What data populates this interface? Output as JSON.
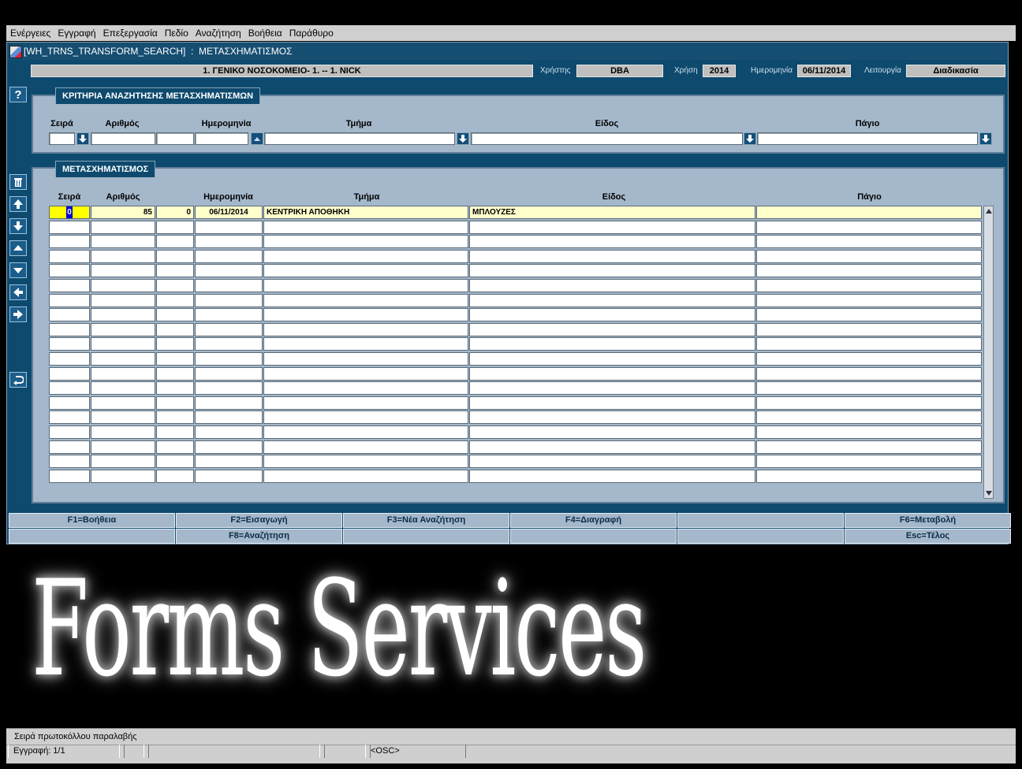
{
  "menu": [
    "Ενέργειες",
    "Εγγραφή",
    "Επεξεργασία",
    "Πεδίο",
    "Αναζήτηση",
    "Βοήθεια",
    "Παράθυρο"
  ],
  "window": {
    "title": "[WH_TRNS_TRANSFORM_SEARCH]  :  ΜΕΤΑΣΧΗΜΑΤΙΣΜΟΣ"
  },
  "infobar": {
    "organization": "1. ΓΕΝΙΚΟ ΝΟΣΟΚΟΜΕΙΟ- 1. -- 1. NICK",
    "user_label": "Χρήστης",
    "user": "DBA",
    "year_label": "Χρήση",
    "year": "2014",
    "date_label": "Ημερομηνία",
    "date": "06/11/2014",
    "function_label": "Λειτουργία",
    "function": "Διαδικασία"
  },
  "criteria": {
    "title": "ΚΡΙΤΗΡΙΑ ΑΝΑΖΗΤΗΣΗΣ ΜΕΤΑΣΧΗΜΑΤΙΣΜΩΝ",
    "columns": {
      "series": "Σειρά",
      "number": "Αριθμός",
      "date": "Ημερομηνία",
      "department": "Τμήμα",
      "item": "Είδος",
      "asset": "Πάγιο"
    }
  },
  "results": {
    "title": "ΜΕΤΑΣΧΗΜΑΤΙΣΜΟΣ",
    "columns": {
      "series": "Σειρά",
      "number": "Αριθμός",
      "date": "Ημερομηνία",
      "department": "Τμήμα",
      "item": "Είδος",
      "asset": "Πάγιο"
    },
    "rows": [
      {
        "series": "0",
        "number": "85",
        "extra": "0",
        "date": "06/11/2014",
        "department": "ΚΕΝΤΡΙΚΗ ΑΠΟΘΗΚΗ",
        "item": "ΜΠΛΟΥΖΕΣ",
        "asset": ""
      }
    ],
    "empty_rows": 18
  },
  "fkeys_row1": [
    "F1=Βοήθεια",
    "F2=Εισαγωγή",
    "F3=Νέα Αναζήτηση",
    "F4=Διαγραφή",
    "",
    "F6=Μεταβολή"
  ],
  "fkeys_row2": [
    "",
    "F8=Αναζήτηση",
    "",
    "",
    "",
    "Esc=Τέλος"
  ],
  "watermark": "Forms Services",
  "status": {
    "hint": "Σειρά πρωτοκόλλου παραλαβής",
    "record": "Εγγραφή: 1/1",
    "mode": "<OSC>"
  },
  "sidebar_icons": [
    "help-icon",
    "trash-icon",
    "first-record-icon",
    "last-record-icon",
    "previous-record-icon",
    "next-record-icon",
    "previous-block-icon",
    "next-block-icon",
    "exit-icon"
  ],
  "colors": {
    "window_bg": "#0e4a6e",
    "panel_bg": "#a5b8cb",
    "current_row": "#ffffcc",
    "current_field": "#ffff00"
  }
}
